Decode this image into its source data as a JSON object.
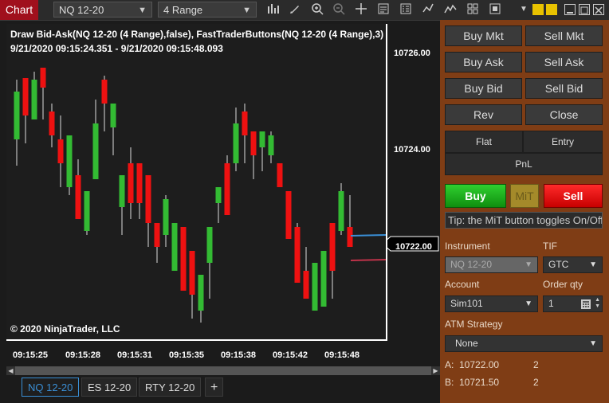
{
  "toolbar": {
    "chart_label": "Chart",
    "instrument": "NQ 12-20",
    "bar_type": "4 Range"
  },
  "chart": {
    "indicator_line": "Draw Bid-Ask(NQ 12-20 (4 Range),false), FastTraderButtons(NQ 12-20 (4 Range),3)",
    "time_range": "9/21/2020 09:15:24.351 - 9/21/2020 09:15:48.093",
    "copyright": "© 2020 NinjaTrader, LLC",
    "current_price": "10722.00",
    "price_labels": [
      "10726.00",
      "10724.00"
    ],
    "time_labels": [
      "09:15:25",
      "09:15:28",
      "09:15:31",
      "09:15:35",
      "09:15:38",
      "09:15:42",
      "09:15:48"
    ],
    "colors": {
      "up": "#33bb33",
      "down": "#ee1111",
      "bid": "#3a8fd6",
      "ask": "#c0334a"
    }
  },
  "instrument_tabs": [
    "NQ 12-20",
    "ES 12-20",
    "RTY 12-20"
  ],
  "instrument_tab_add": "+",
  "panel": {
    "buy_mkt": "Buy Mkt",
    "sell_mkt": "Sell Mkt",
    "buy_ask": "Buy Ask",
    "sell_ask": "Sell Ask",
    "buy_bid": "Buy Bid",
    "sell_bid": "Sell Bid",
    "rev": "Rev",
    "close": "Close",
    "flat": "Flat",
    "entry": "Entry",
    "pnl": "PnL",
    "buy": "Buy",
    "mit": "MiT",
    "sell": "Sell",
    "tip": "Tip: the MiT button toggles On/Off",
    "instrument_label": "Instrument",
    "instrument_value": "NQ 12-20",
    "tif_label": "TIF",
    "tif_value": "GTC",
    "account_label": "Account",
    "account_value": "Sim101",
    "order_qty_label": "Order qty",
    "order_qty_value": "1",
    "atm_label": "ATM Strategy",
    "atm_value": "None",
    "ask_row": {
      "label": "A:",
      "price": "10722.00",
      "size": "2"
    },
    "bid_row": {
      "label": "B:",
      "price": "10721.50",
      "size": "2"
    }
  }
}
